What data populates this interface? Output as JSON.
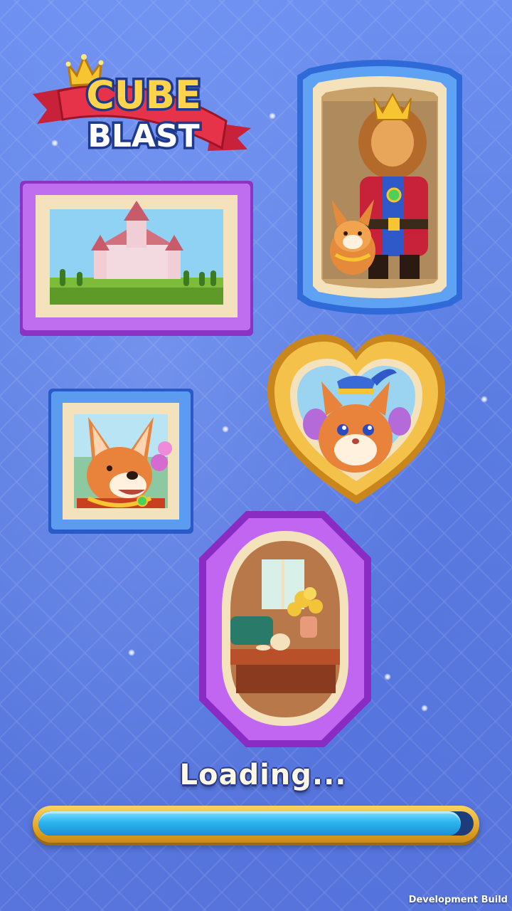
{
  "app": {
    "logo": {
      "line1": "CUBE",
      "line2": "BLAST"
    }
  },
  "loading": {
    "label": "Loading...",
    "progress": 0.97
  },
  "footer": {
    "build_label": "Development Build"
  },
  "colors": {
    "background": "#5f7fe0",
    "progress_fill": "#2bb4ee",
    "progress_frame": "#e7a92a",
    "frame_purple": "#b45ae6",
    "frame_blue": "#3a7ce6",
    "frame_gold": "#f0b436"
  },
  "frames": [
    {
      "name": "castle-painting",
      "frame_color": "purple"
    },
    {
      "name": "lion-king-painting",
      "frame_color": "blue"
    },
    {
      "name": "cat-heart-painting",
      "frame_color": "gold"
    },
    {
      "name": "corgi-painting",
      "frame_color": "blue"
    },
    {
      "name": "living-room-painting",
      "frame_color": "purple"
    }
  ]
}
